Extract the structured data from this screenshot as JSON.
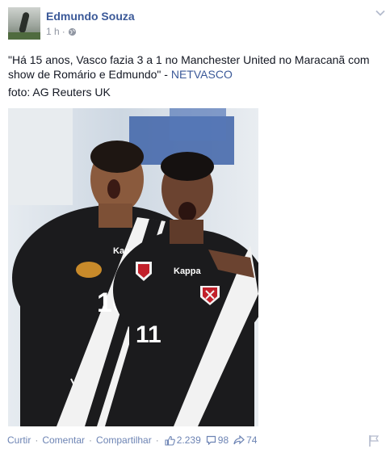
{
  "post": {
    "author": "Edmundo Souza",
    "time": "1 h",
    "dot": "·",
    "text": "\"Há 15 anos, Vasco fazia 3 a 1 no Manchester United no Maracanã com show de Romário e Edmundo\" - ",
    "link": "NETVASCO",
    "credit": "foto: AG Reuters UK"
  },
  "photo": {
    "jersey_numbers": [
      "10",
      "11"
    ],
    "brand": "Kappa",
    "colors": {
      "jersey": "#1b1b1d",
      "sash": "#f2f2f2",
      "cross": "#c2202a",
      "background_blue": "#3e63a8",
      "background_pale": "#dfe6ee"
    }
  },
  "actions": {
    "like": "Curtir",
    "comment": "Comentar",
    "share": "Compartilhar",
    "separator": "·",
    "likes_count": "2.239",
    "comments_count": "98",
    "shares_count": "74"
  },
  "icons": [
    "globe-icon",
    "chevron-down-icon",
    "thumbs-up-icon",
    "comment-icon",
    "share-icon",
    "flag-icon"
  ]
}
